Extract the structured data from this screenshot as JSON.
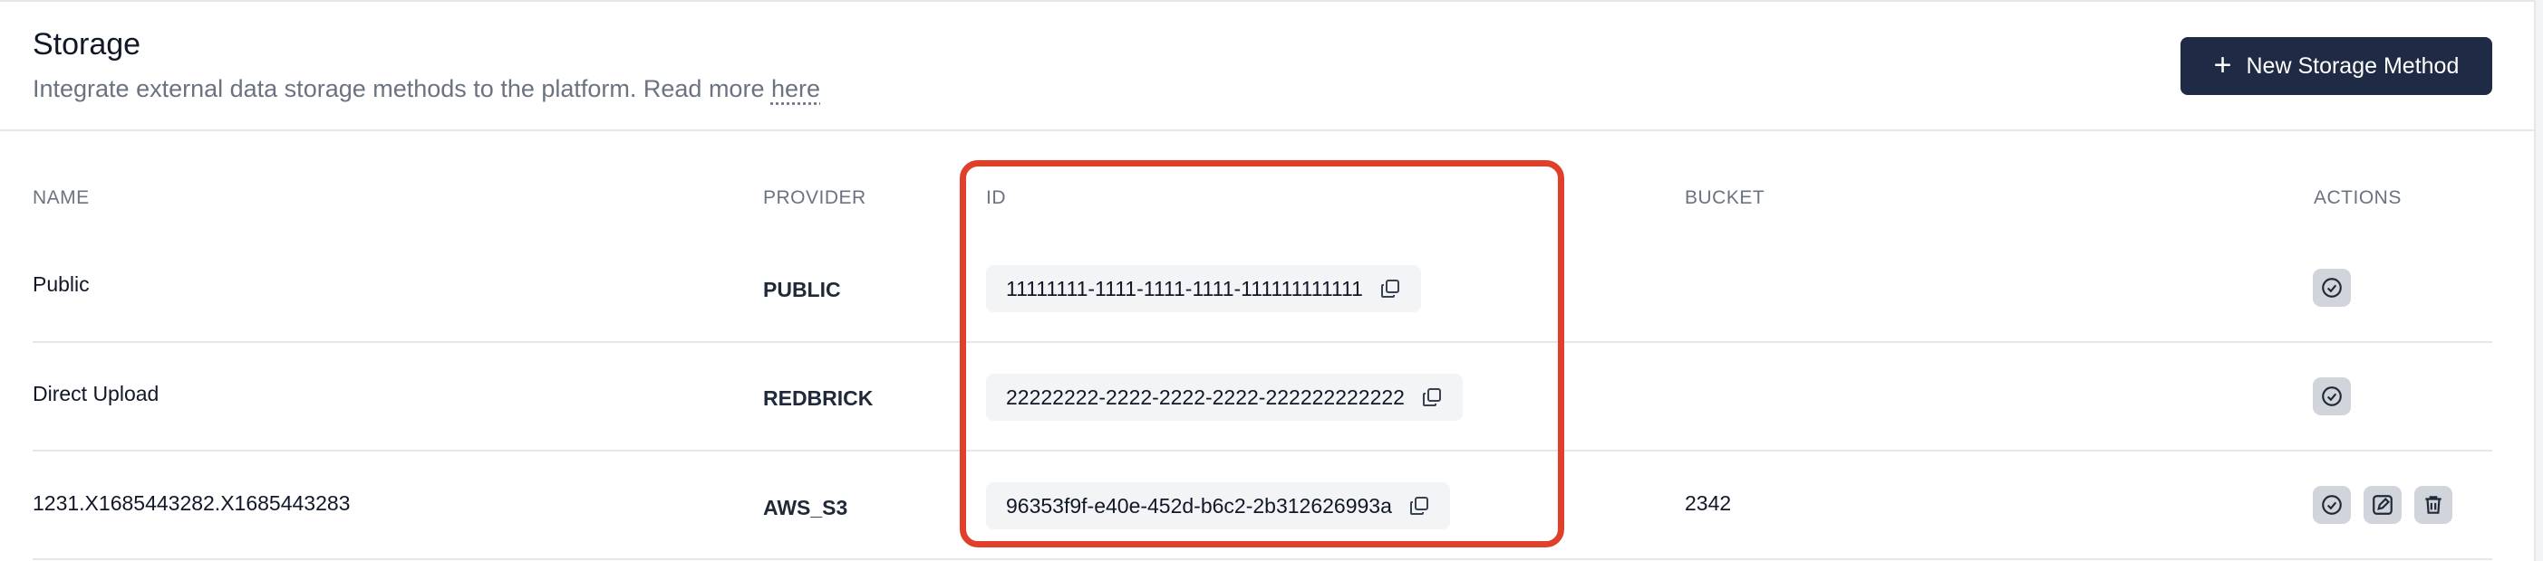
{
  "header": {
    "title": "Storage",
    "subtitle": "Integrate external data storage methods to the platform. Read more",
    "subtitle_link": "here",
    "new_button_label": "New Storage Method",
    "new_button_icon": "plus-icon"
  },
  "table": {
    "columns": {
      "name": "NAME",
      "provider": "PROVIDER",
      "id": "ID",
      "bucket": "BUCKET",
      "actions": "ACTIONS"
    },
    "rows": [
      {
        "name": "Public",
        "provider": "PUBLIC",
        "id": "11111111-1111-1111-1111-111111111111",
        "bucket": "",
        "actions": [
          "check-circle-icon"
        ]
      },
      {
        "name": "Direct Upload",
        "provider": "REDBRICK",
        "id": "22222222-2222-2222-2222-222222222222",
        "bucket": "",
        "actions": [
          "check-circle-icon"
        ]
      },
      {
        "name": "1231.X1685443282.X1685443283",
        "provider": "AWS_S3",
        "id": "96353f9f-e40e-452d-b6c2-2b312626993a",
        "bucket": "2342",
        "actions": [
          "check-circle-icon",
          "edit-icon",
          "trash-icon"
        ]
      }
    ]
  },
  "colors": {
    "primary_button": "#1f2a44",
    "highlight": "#e0402a",
    "pill_bg": "#f3f4f6",
    "action_bg": "#d1d5db"
  }
}
